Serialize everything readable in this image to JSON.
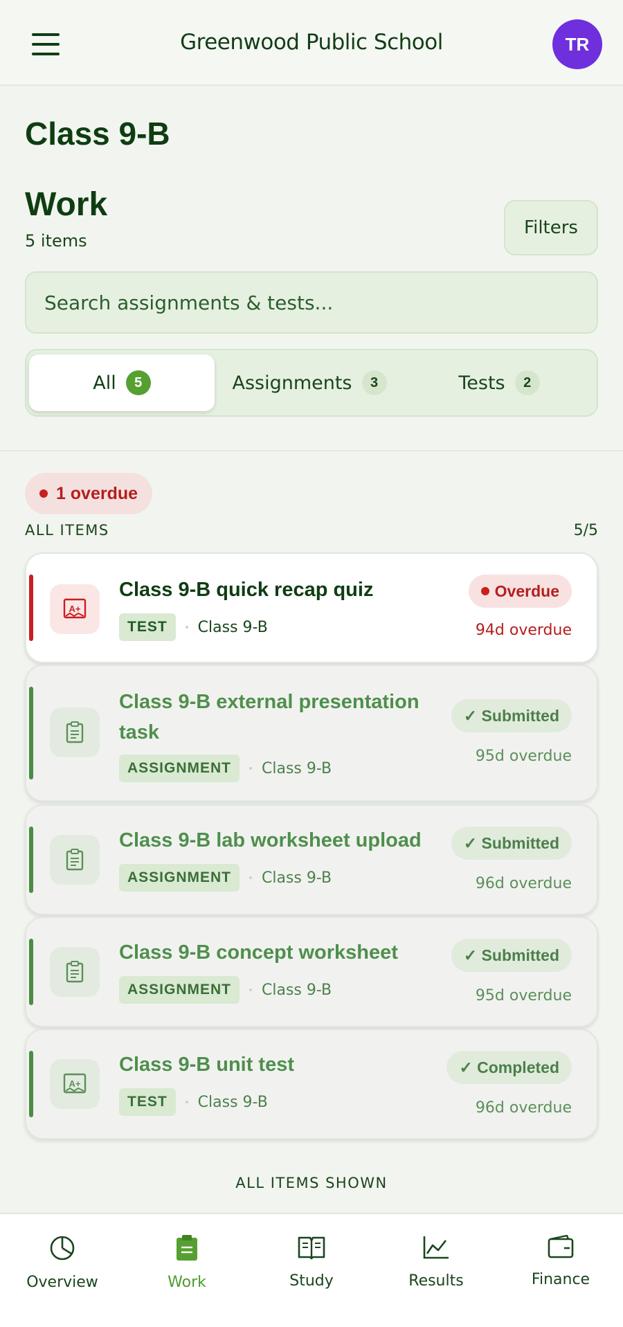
{
  "header": {
    "app_title": "Greenwood Public School",
    "avatar_initials": "TR"
  },
  "page": {
    "class_title": "Class 9-B",
    "section_title": "Work",
    "item_count": "5 items",
    "filters_label": "Filters"
  },
  "search": {
    "placeholder": "Search assignments & tests..."
  },
  "segments": [
    {
      "label": "All",
      "count": "5",
      "active": true
    },
    {
      "label": "Assignments",
      "count": "3",
      "active": false
    },
    {
      "label": "Tests",
      "count": "2",
      "active": false
    }
  ],
  "overdue_chip": "1 overdue",
  "list": {
    "label": "ALL ITEMS",
    "count": "5/5",
    "items": [
      {
        "title": "Class 9-B quick recap quiz",
        "type": "TEST",
        "class": "Class 9-B",
        "status": "Overdue",
        "due": "94d overdue",
        "icon": "test-grade-icon"
      },
      {
        "title": "Class 9-B external presentation task",
        "type": "ASSIGNMENT",
        "class": "Class 9-B",
        "status": "✓ Submitted",
        "due": "95d overdue",
        "icon": "clipboard-icon"
      },
      {
        "title": "Class 9-B lab worksheet upload",
        "type": "ASSIGNMENT",
        "class": "Class 9-B",
        "status": "✓ Submitted",
        "due": "96d overdue",
        "icon": "clipboard-icon"
      },
      {
        "title": "Class 9-B concept worksheet",
        "type": "ASSIGNMENT",
        "class": "Class 9-B",
        "status": "✓ Submitted",
        "due": "95d overdue",
        "icon": "clipboard-icon"
      },
      {
        "title": "Class 9-B unit test",
        "type": "TEST",
        "class": "Class 9-B",
        "status": "✓ Completed",
        "due": "96d overdue",
        "icon": "test-grade-icon"
      }
    ],
    "end_label": "ALL ITEMS SHOWN"
  },
  "nav": [
    {
      "label": "Overview",
      "icon": "pie-chart-icon",
      "active": false
    },
    {
      "label": "Work",
      "icon": "clipboard-icon",
      "active": true
    },
    {
      "label": "Study",
      "icon": "book-icon",
      "active": false
    },
    {
      "label": "Results",
      "icon": "line-chart-icon",
      "active": false
    },
    {
      "label": "Finance",
      "icon": "wallet-icon",
      "active": false
    }
  ],
  "colors": {
    "accent_green": "#4c9b2f",
    "dark_green": "#0f3d12",
    "overdue_red": "#c8201f",
    "avatar_purple": "#6f2fdc"
  }
}
